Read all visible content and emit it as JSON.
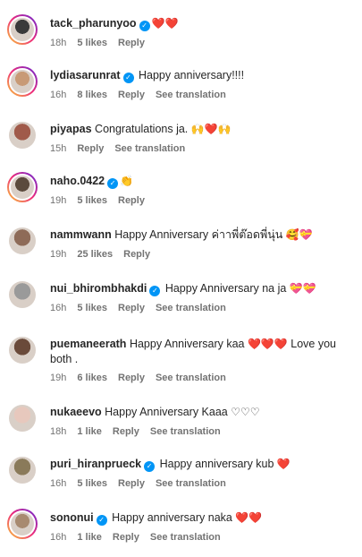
{
  "comments": [
    {
      "username": "tack_pharunyoo",
      "verified": true,
      "text": "",
      "emoji": "❤️❤️",
      "time": "18h",
      "likes": "5 likes",
      "reply": "Reply",
      "translation": "",
      "avatar_color": "#3a3a3a"
    },
    {
      "username": "lydiasarunrat",
      "verified": true,
      "text": "Happy anniversary!!!!",
      "emoji": "",
      "time": "16h",
      "likes": "8 likes",
      "reply": "Reply",
      "translation": "See translation",
      "avatar_color": "#c89a76"
    },
    {
      "username": "piyapas",
      "verified": false,
      "text": "Congratulations ja.",
      "emoji": "🙌❤️🙌",
      "time": "15h",
      "likes": "",
      "reply": "Reply",
      "translation": "See translation",
      "avatar_color": "#a05a4a"
    },
    {
      "username": "naho.0422",
      "verified": true,
      "text": "",
      "emoji": "👏",
      "time": "19h",
      "likes": "5 likes",
      "reply": "Reply",
      "translation": "",
      "avatar_color": "#5b4a3d"
    },
    {
      "username": "nammwann",
      "verified": false,
      "text": "Happy Anniversary ค่าาพี่ต๊อดพี่นุ่น",
      "emoji": "🥰💝",
      "time": "19h",
      "likes": "25 likes",
      "reply": "Reply",
      "translation": "",
      "avatar_color": "#8e6b58"
    },
    {
      "username": "nui_bhirombhakdi",
      "verified": true,
      "text": "Happy Anniversary na ja",
      "emoji": "💝💝",
      "time": "16h",
      "likes": "5 likes",
      "reply": "Reply",
      "translation": "See translation",
      "avatar_color": "#9a9a9a"
    },
    {
      "username": "puemaneerath",
      "verified": false,
      "text": "Happy Anniversary kaa",
      "emoji": "❤️❤️❤️",
      "text2": "Love you both .",
      "time": "19h",
      "likes": "6 likes",
      "reply": "Reply",
      "translation": "See translation",
      "avatar_color": "#6a4a3a"
    },
    {
      "username": "nukaeevo",
      "verified": false,
      "text": "Happy Anniversary Kaaa",
      "emoji": "♡♡♡",
      "time": "18h",
      "likes": "1 like",
      "reply": "Reply",
      "translation": "See translation",
      "avatar_color": "#e7c8bd"
    },
    {
      "username": "puri_hiranprueck",
      "verified": true,
      "text": "Happy anniversary kub",
      "emoji": "❤️",
      "time": "16h",
      "likes": "5 likes",
      "reply": "Reply",
      "translation": "See translation",
      "avatar_color": "#8a7a5a"
    },
    {
      "username": "sononui",
      "verified": true,
      "text": "Happy anniversary naka",
      "emoji": "❤️❤️",
      "time": "16h",
      "likes": "1 like",
      "reply": "Reply",
      "translation": "See translation",
      "avatar_color": "#a88a70"
    }
  ]
}
